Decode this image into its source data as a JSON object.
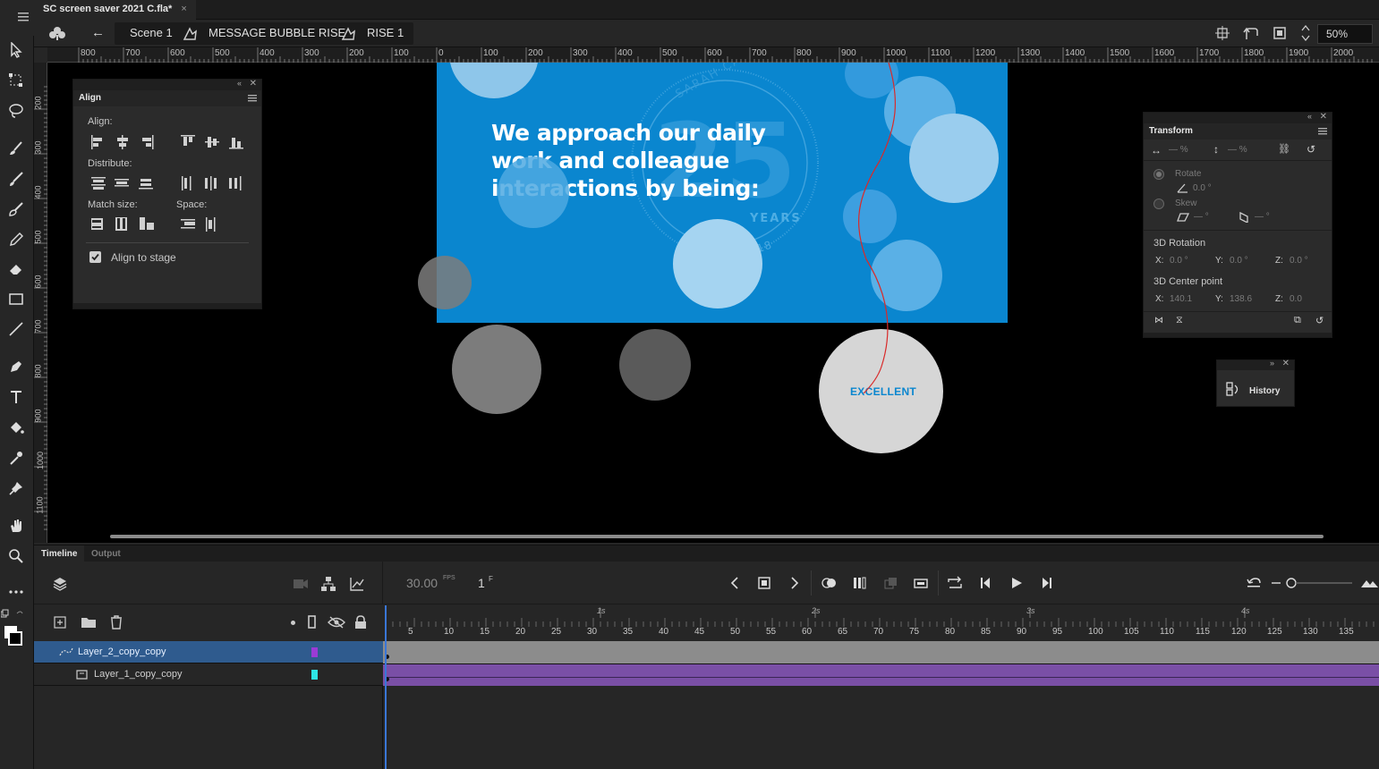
{
  "document": {
    "tab_title": "SC screen saver 2021 C.fla*",
    "tab_close": "×"
  },
  "editbar": {
    "back": "←",
    "crumbs": [
      "Scene 1",
      "MESSAGE BUBBLE RISE",
      "RISE 1"
    ],
    "zoom": "50%"
  },
  "rulers": {
    "horizontal": [
      "800",
      "700",
      "600",
      "500",
      "400",
      "300",
      "200",
      "100",
      "0",
      "100",
      "200",
      "300",
      "400",
      "500",
      "600",
      "700",
      "800",
      "900",
      "1000",
      "1100",
      "1200",
      "1300",
      "1400",
      "1500",
      "1600",
      "1700",
      "1800",
      "1900",
      "2000"
    ],
    "vertical": [
      "200",
      "300",
      "400",
      "500",
      "600",
      "700",
      "800",
      "900",
      "1000",
      "1100"
    ]
  },
  "stage": {
    "headline": "We approach our daily work and colleague interactions by being:",
    "bubble_label": "EXCELLENT",
    "watermark": {
      "arc_top": "SARAH CANNON",
      "number": "25",
      "years": "YEARS",
      "range": "1993-2018"
    },
    "colors": {
      "stage_blue": "#0a86cf",
      "light_bubble": "#8ec6ea",
      "grey_bubble": "#7c7c7c",
      "dark_grey_bubble": "#5a5a5a",
      "white_bubble": "#d6d6d6",
      "motion_path": "#d92a2a"
    }
  },
  "align_panel": {
    "title": "Align",
    "align_label": "Align:",
    "distribute_label": "Distribute:",
    "match_size_label": "Match size:",
    "space_label": "Space:",
    "align_to_stage": "Align to stage",
    "align_to_stage_checked": true
  },
  "transform_panel": {
    "title": "Transform",
    "width_pct": "— %",
    "height_pct": "— %",
    "rotate_label": "Rotate",
    "rotate_value": "0.0 °",
    "skew_label": "Skew",
    "skew_h": "— °",
    "skew_v": "— °",
    "rotation3d_label": "3D Rotation",
    "rot_x_label": "X:",
    "rot_x": "0.0 °",
    "rot_y_label": "Y:",
    "rot_y": "0.0 °",
    "rot_z_label": "Z:",
    "rot_z": "0.0 °",
    "center3d_label": "3D Center point",
    "cp_x_label": "X:",
    "cp_x": "140.1",
    "cp_y_label": "Y:",
    "cp_y": "138.6",
    "cp_z_label": "Z:",
    "cp_z": "0.0"
  },
  "history_panel": {
    "title": "History"
  },
  "timeline": {
    "tabs": [
      "Timeline",
      "Output"
    ],
    "fps": "30.00",
    "fps_unit": "FPS",
    "frame": "1",
    "frame_unit": "F",
    "seconds": [
      "1s",
      "2s",
      "3s",
      "4s"
    ],
    "frame_numbers": [
      "5",
      "10",
      "15",
      "20",
      "25",
      "30",
      "35",
      "40",
      "45",
      "50",
      "55",
      "60",
      "65",
      "70",
      "75",
      "80",
      "85",
      "90",
      "95",
      "100",
      "105",
      "110",
      "115",
      "120",
      "125",
      "130",
      "135"
    ],
    "layers": [
      {
        "name": "Layer_2_copy_copy",
        "color": "#9b3bd6",
        "selected": true
      },
      {
        "name": "Layer_1_copy_copy",
        "color": "#2ee6e6",
        "selected": false
      }
    ]
  }
}
